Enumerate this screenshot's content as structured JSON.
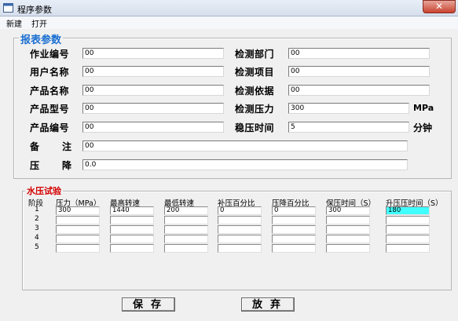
{
  "window": {
    "title": "程序参数",
    "close": "✕"
  },
  "menu": [
    "新建",
    "打开"
  ],
  "report": {
    "legend": "报表参数",
    "left": [
      {
        "label": "作业编号",
        "value": "00"
      },
      {
        "label": "用户名称",
        "value": "00"
      },
      {
        "label": "产品名称",
        "value": "00"
      },
      {
        "label": "产品型号",
        "value": "00"
      },
      {
        "label": "产品编号",
        "value": "00"
      }
    ],
    "right": [
      {
        "label": "检测部门",
        "value": "00",
        "unit": ""
      },
      {
        "label": "检测项目",
        "value": "00",
        "unit": ""
      },
      {
        "label": "检测依据",
        "value": "00",
        "unit": ""
      },
      {
        "label": "检测压力",
        "value": "300",
        "unit": "MPa"
      },
      {
        "label": "稳压时间",
        "value": "5",
        "unit": "分钟"
      }
    ],
    "remark": {
      "label1": "备",
      "label2": "注",
      "value": "00"
    },
    "pressure_drop": {
      "label1": "压",
      "label2": "降",
      "value": "0.0"
    }
  },
  "water_test": {
    "legend": "水压试验",
    "stage_header": "阶段",
    "columns": [
      "压力（MPa）",
      "最高转速",
      "最低转速",
      "补压百分比",
      "压降百分比",
      "保压时间（S）",
      "升压压时间（S）"
    ],
    "rows": [
      {
        "stage": "1",
        "cells": [
          "300",
          "1440",
          "200",
          "0",
          "0",
          "300",
          "180"
        ]
      },
      {
        "stage": "2",
        "cells": [
          "",
          "",
          "",
          "",
          "",
          "",
          ""
        ]
      },
      {
        "stage": "3",
        "cells": [
          "",
          "",
          "",
          "",
          "",
          "",
          ""
        ]
      },
      {
        "stage": "4",
        "cells": [
          "",
          "",
          "",
          "",
          "",
          "",
          ""
        ]
      },
      {
        "stage": "5",
        "cells": [
          "",
          "",
          "",
          "",
          "",
          "",
          ""
        ]
      }
    ]
  },
  "buttons": {
    "save": "保存",
    "discard": "放弃"
  },
  "colors": {
    "legend_blue": "#1a6fd1",
    "legend_red": "#d40000",
    "highlight_cell": "#40ffff"
  }
}
